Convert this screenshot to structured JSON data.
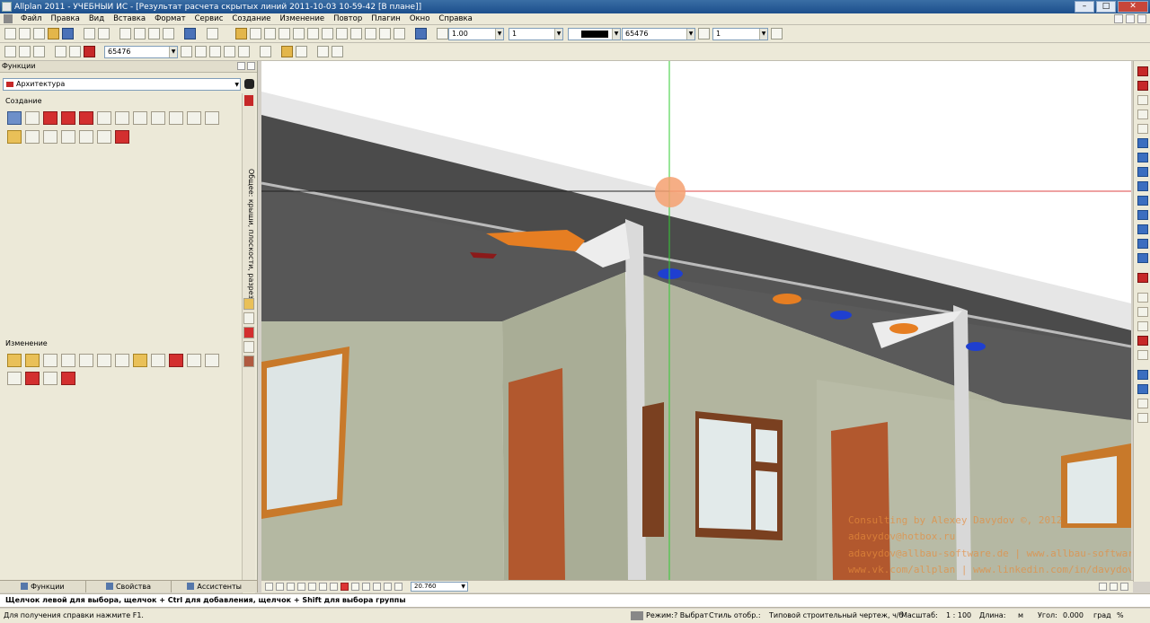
{
  "title": "Allplan 2011 - УЧЕБНЫЙ ИС - [Результат расчета скрытых линий 2011-10-03 10-59-42 [В плане]]",
  "window_buttons": {
    "min": "–",
    "max": "□",
    "close": "✕"
  },
  "menu": [
    "Файл",
    "Правка",
    "Вид",
    "Вставка",
    "Формат",
    "Сервис",
    "Создание",
    "Изменение",
    "Повтор",
    "Плагин",
    "Окно",
    "Справка"
  ],
  "toolbar": {
    "line_thickness": "1.00",
    "line_type": "1",
    "pen_color_value": "",
    "layer_value": "65476",
    "hatch_value": "1",
    "second_layer_value": "65476"
  },
  "left_panel": {
    "header": "Функции",
    "module": "Архитектура",
    "section_create": "Создание",
    "section_modify": "Изменение",
    "vertical_tab": "Общее: крыши, плоскости, разрезы",
    "tabs": [
      "Функции",
      "Свойства",
      "Ассистенты"
    ]
  },
  "viewport_bar": {
    "zoom_value": "20.760"
  },
  "watermark": {
    "line1": "Consulting by Alexey Davydov ©, 2012",
    "line2": "adavydov@hotbox.ru",
    "line3": "adavydov@allbau-software.de | www.allbau-software.de",
    "line4": "www.vk.com/allplan | www.linkedin.com/in/davydovalexey"
  },
  "command_line": "Щелчок левой для выбора, щелчок + Ctrl для добавления, щелчок + Shift для выбора группы",
  "status": {
    "help": "Для получения справки нажмите F1.",
    "mode_label": "Режим:",
    "mode_value": "? Выбрат",
    "style_label": "Стиль отобр.:",
    "style_value": "Типовой строительный чертеж, ч/б",
    "scale_label": "Масштаб:",
    "scale_value": "1 : 100",
    "length_label": "Длина:",
    "length_value": "м",
    "angle_label": "Угол:",
    "angle_value": "0.000",
    "angle_unit": "град"
  },
  "colors": {
    "title_bar": "#1c4f8c",
    "panel_bg": "#ece9d8",
    "wall": "#b5b9a2",
    "slab_dark": "#4c4c4c",
    "door": "#b2582e",
    "frame": "#c87a2a",
    "accent_red": "#c62828"
  }
}
